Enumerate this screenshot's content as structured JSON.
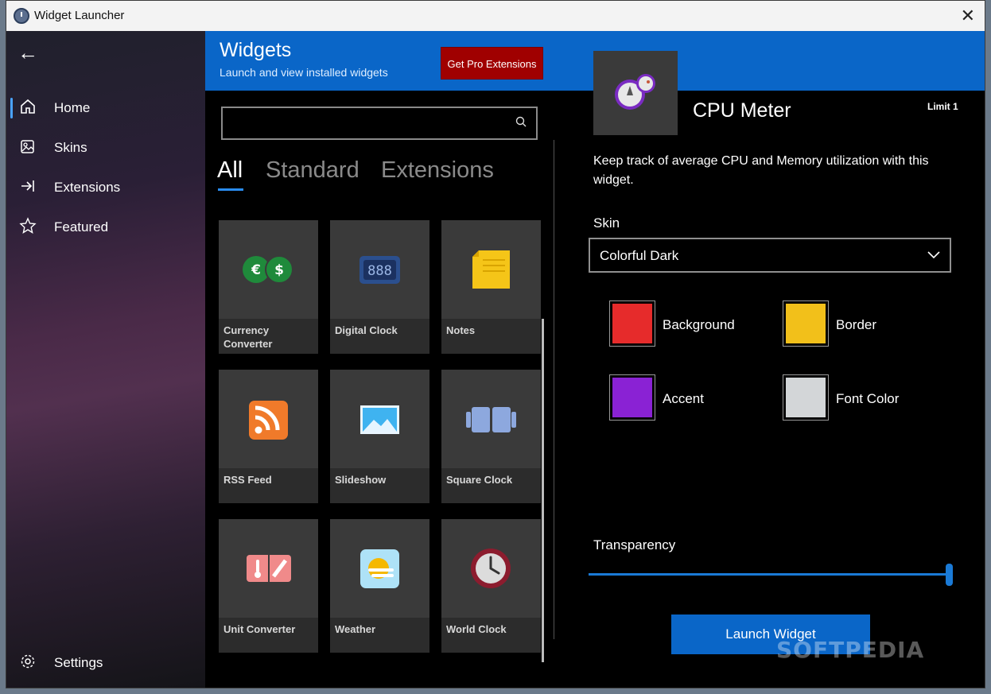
{
  "window": {
    "title": "Widget Launcher"
  },
  "sidebar": {
    "items": [
      {
        "label": "Home",
        "icon": "home-icon"
      },
      {
        "label": "Skins",
        "icon": "skins-icon"
      },
      {
        "label": "Extensions",
        "icon": "extensions-icon"
      },
      {
        "label": "Featured",
        "icon": "star-icon"
      }
    ],
    "settings_label": "Settings"
  },
  "header": {
    "title": "Widgets",
    "subtitle": "Launch and view installed widgets",
    "pro_button": "Get Pro Extensions"
  },
  "search": {
    "placeholder": "",
    "value": ""
  },
  "tabs": [
    {
      "label": "All",
      "active": true
    },
    {
      "label": "Standard",
      "active": false
    },
    {
      "label": "Extensions",
      "active": false
    }
  ],
  "widgets": [
    {
      "name": "Currency Converter",
      "icon": "currency-icon"
    },
    {
      "name": "Digital Clock",
      "icon": "digital-clock-icon"
    },
    {
      "name": "Notes",
      "icon": "notes-icon"
    },
    {
      "name": "RSS Feed",
      "icon": "rss-icon"
    },
    {
      "name": "Slideshow",
      "icon": "slideshow-icon"
    },
    {
      "name": "Square Clock",
      "icon": "square-clock-icon"
    },
    {
      "name": "Unit Converter",
      "icon": "unit-converter-icon"
    },
    {
      "name": "Weather",
      "icon": "weather-icon"
    },
    {
      "name": "World Clock",
      "icon": "world-clock-icon"
    }
  ],
  "detail": {
    "title": "CPU Meter",
    "limit": "Limit 1",
    "description": "Keep track of average CPU and Memory utilization with this widget.",
    "skin_label": "Skin",
    "skin_value": "Colorful Dark",
    "colors": [
      {
        "label": "Background",
        "color": "#e62b2b"
      },
      {
        "label": "Border",
        "color": "#f2c01a"
      },
      {
        "label": "Accent",
        "color": "#8a22d4"
      },
      {
        "label": "Font Color",
        "color": "#d3d6d8"
      }
    ],
    "transparency_label": "Transparency",
    "transparency_value": 1.0,
    "launch_button": "Launch Widget"
  },
  "watermark": "SOFTPEDIA",
  "accent_color": "#0a66c8"
}
